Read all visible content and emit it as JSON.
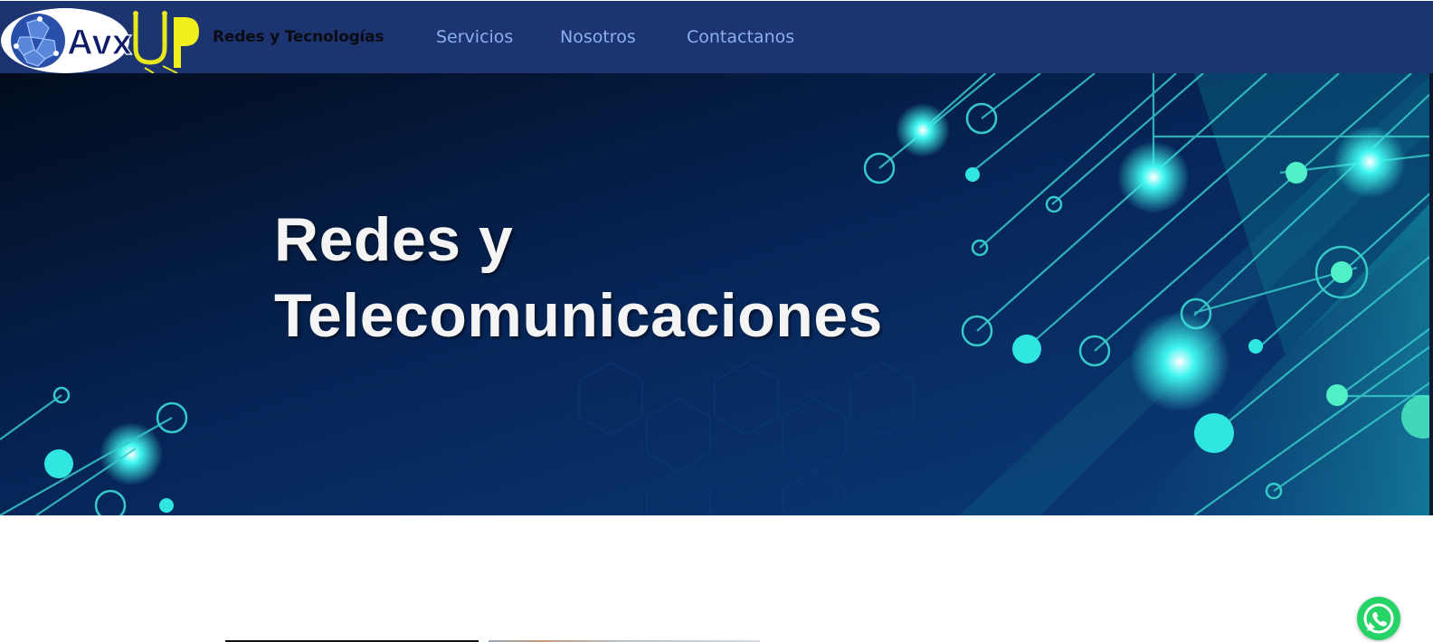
{
  "header": {
    "brand_name": "Redes y Tecnologías",
    "logo_text": "AvxUP",
    "nav": {
      "servicios": "Servicios",
      "nosotros": "Nosotros",
      "contactanos": "Contactanos"
    }
  },
  "hero": {
    "title_line1": "Redes y",
    "title_line2": "Telecomunicaciones"
  },
  "colors": {
    "navbar": "#1c346f",
    "nav_link": "#8ab0f2",
    "hero_dark": "#031633",
    "circuit_cyan": "#2fe6e0",
    "whatsapp": "#25d366"
  },
  "icons": {
    "logo": "globe-logo-icon",
    "whatsapp": "whatsapp-icon"
  }
}
